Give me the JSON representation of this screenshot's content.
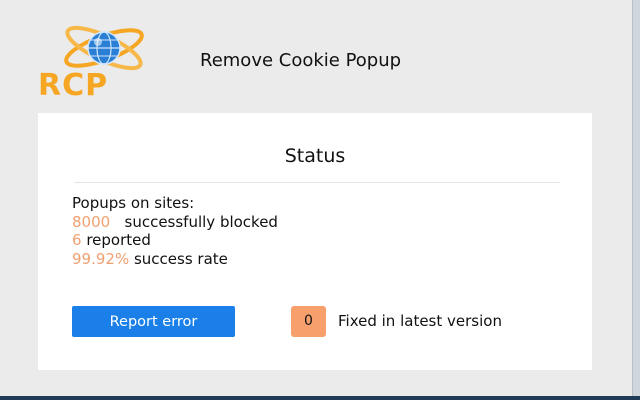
{
  "header": {
    "logo_text": "RCP",
    "title": "Remove Cookie Popup"
  },
  "status": {
    "heading": "Status",
    "intro": "Popups on sites:",
    "blocked_count": "8000",
    "blocked_label": "successfully blocked",
    "reported_count": "6",
    "reported_label": "reported",
    "success_rate": "99.92%",
    "success_label": "success rate"
  },
  "actions": {
    "report_label": "Report error",
    "fixed_count": "0",
    "fixed_label": "Fixed in latest version"
  },
  "colors": {
    "accent_orange": "#f5a623",
    "number_orange": "#f0a070",
    "button_blue": "#1a7fe8",
    "badge_orange": "#f7a06c"
  },
  "icons": {
    "logo": "globe-atom-logo-icon"
  }
}
